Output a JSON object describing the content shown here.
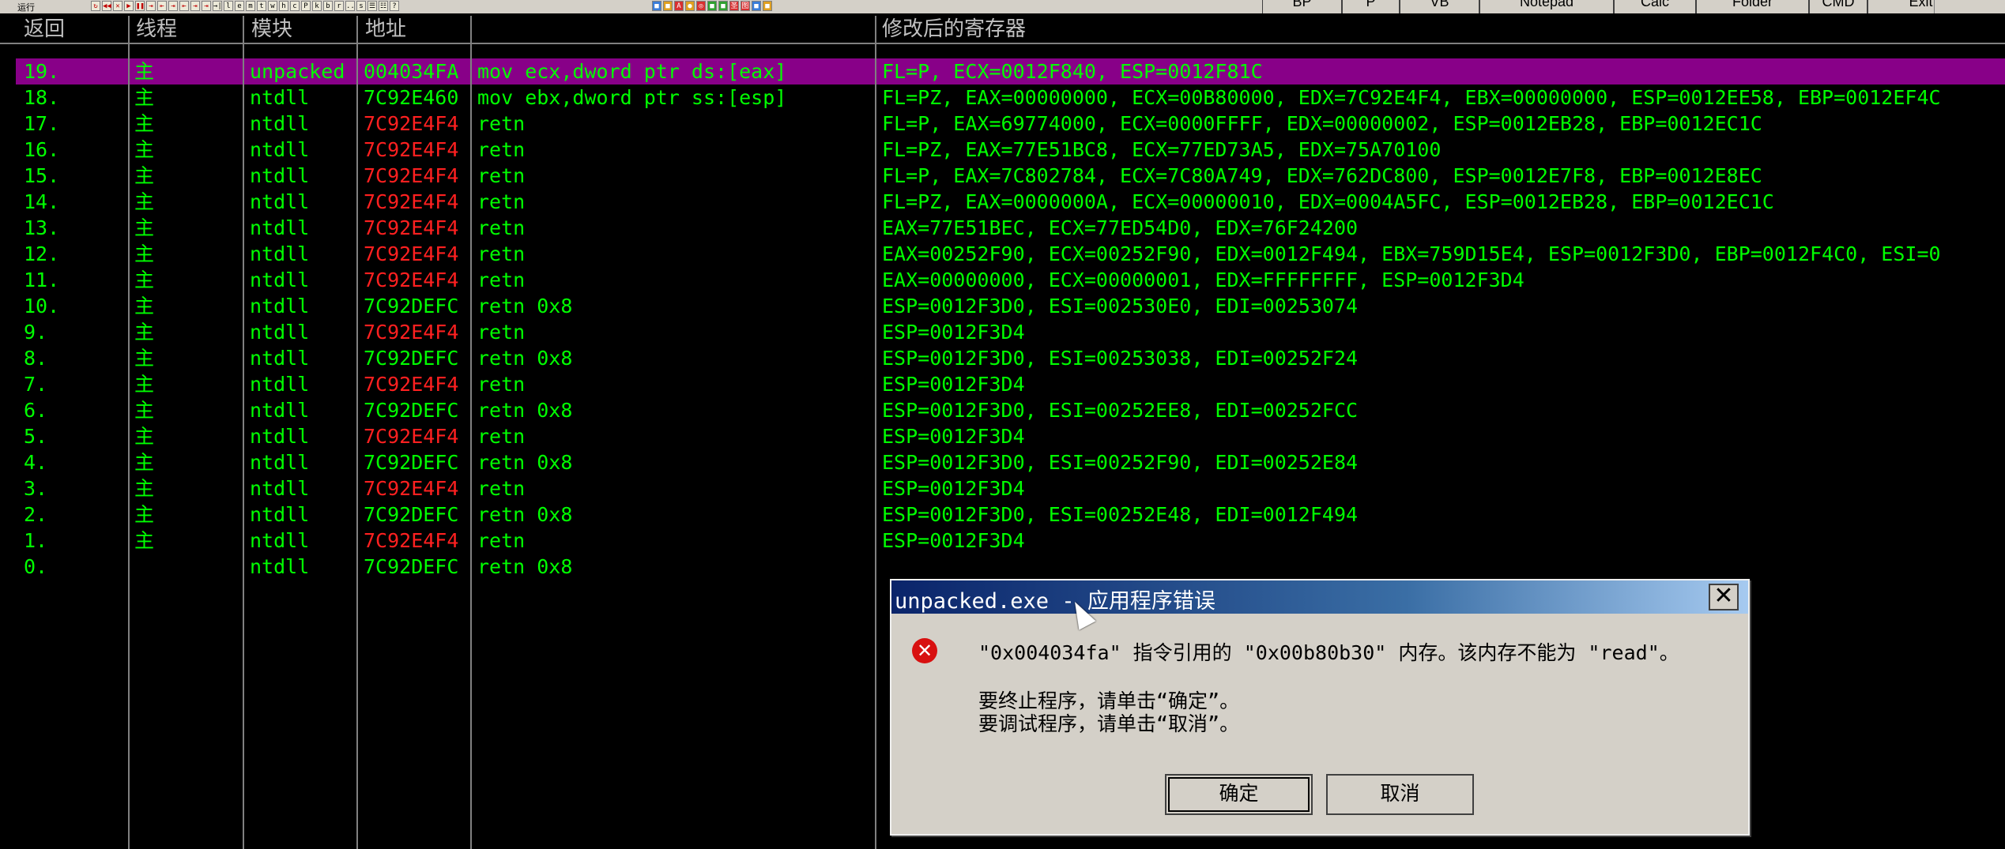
{
  "toolbar": {
    "label": "运行",
    "icons_group1": [
      "↻",
      "◀◀",
      "✕",
      "▶",
      "❚❚",
      "⇥",
      "⇤",
      "⇥",
      "⇤",
      "⇥",
      "⇥",
      "→|",
      "l",
      "e",
      "m",
      "t",
      "w",
      "h",
      "c",
      "P",
      "k",
      "b",
      "r",
      "...",
      "s",
      "☰",
      "☷",
      "?"
    ],
    "icons_group2": [
      "■",
      "■",
      "A",
      "●",
      "◎",
      "■",
      "■",
      "圣",
      "图",
      "■",
      "■"
    ],
    "buttons": [
      "BP",
      "P",
      "VB",
      "Notepad",
      "Calc",
      "Folder",
      "CMD",
      "Exit"
    ]
  },
  "columns": {
    "ret": "返回",
    "thread": "线程",
    "module": "模块",
    "address": "地址",
    "instruction": "",
    "registers": "修改后的寄存器"
  },
  "rows": [
    {
      "ret": "19.",
      "thread": "主",
      "module": "unpacked",
      "address": "004034FA",
      "addr_red": false,
      "instr": "mov ecx,dword ptr ds:[eax]",
      "regs": "FL=P, ECX=0012F840, ESP=0012F81C",
      "selected": true
    },
    {
      "ret": "18.",
      "thread": "主",
      "module": "ntdll",
      "address": "7C92E460",
      "addr_red": false,
      "instr": "mov ebx,dword ptr ss:[esp]",
      "regs": "FL=PZ, EAX=00000000, ECX=00B80000, EDX=7C92E4F4, EBX=00000000, ESP=0012EE58, EBP=0012EF4C",
      "selected": false
    },
    {
      "ret": "17.",
      "thread": "主",
      "module": "ntdll",
      "address": "7C92E4F4",
      "addr_red": true,
      "instr": "retn",
      "regs": "FL=P, EAX=69774000, ECX=0000FFFF, EDX=00000002, ESP=0012EB28, EBP=0012EC1C",
      "selected": false
    },
    {
      "ret": "16.",
      "thread": "主",
      "module": "ntdll",
      "address": "7C92E4F4",
      "addr_red": true,
      "instr": "retn",
      "regs": "FL=PZ, EAX=77E51BC8, ECX=77ED73A5, EDX=75A70100",
      "selected": false
    },
    {
      "ret": "15.",
      "thread": "主",
      "module": "ntdll",
      "address": "7C92E4F4",
      "addr_red": true,
      "instr": "retn",
      "regs": "FL=P, EAX=7C802784, ECX=7C80A749, EDX=762DC800, ESP=0012E7F8, EBP=0012E8EC",
      "selected": false
    },
    {
      "ret": "14.",
      "thread": "主",
      "module": "ntdll",
      "address": "7C92E4F4",
      "addr_red": true,
      "instr": "retn",
      "regs": "FL=PZ, EAX=0000000A, ECX=00000010, EDX=0004A5FC, ESP=0012EB28, EBP=0012EC1C",
      "selected": false
    },
    {
      "ret": "13.",
      "thread": "主",
      "module": "ntdll",
      "address": "7C92E4F4",
      "addr_red": true,
      "instr": "retn",
      "regs": "EAX=77E51BEC, ECX=77ED54D0, EDX=76F24200",
      "selected": false
    },
    {
      "ret": "12.",
      "thread": "主",
      "module": "ntdll",
      "address": "7C92E4F4",
      "addr_red": true,
      "instr": "retn",
      "regs": "EAX=00252F90, ECX=00252F90, EDX=0012F494, EBX=759D15E4, ESP=0012F3D0, EBP=0012F4C0, ESI=0",
      "selected": false
    },
    {
      "ret": "11.",
      "thread": "主",
      "module": "ntdll",
      "address": "7C92E4F4",
      "addr_red": true,
      "instr": "retn",
      "regs": "EAX=00000000, ECX=00000001, EDX=FFFFFFFF, ESP=0012F3D4",
      "selected": false
    },
    {
      "ret": "10.",
      "thread": "主",
      "module": "ntdll",
      "address": "7C92DEFC",
      "addr_red": false,
      "instr": "retn 0x8",
      "regs": "ESP=0012F3D0, ESI=002530E0, EDI=00253074",
      "selected": false
    },
    {
      "ret": "9.",
      "thread": "主",
      "module": "ntdll",
      "address": "7C92E4F4",
      "addr_red": true,
      "instr": "retn",
      "regs": "ESP=0012F3D4",
      "selected": false
    },
    {
      "ret": "8.",
      "thread": "主",
      "module": "ntdll",
      "address": "7C92DEFC",
      "addr_red": false,
      "instr": "retn 0x8",
      "regs": "ESP=0012F3D0, ESI=00253038, EDI=00252F24",
      "selected": false
    },
    {
      "ret": "7.",
      "thread": "主",
      "module": "ntdll",
      "address": "7C92E4F4",
      "addr_red": true,
      "instr": "retn",
      "regs": "ESP=0012F3D4",
      "selected": false
    },
    {
      "ret": "6.",
      "thread": "主",
      "module": "ntdll",
      "address": "7C92DEFC",
      "addr_red": false,
      "instr": "retn 0x8",
      "regs": "ESP=0012F3D0, ESI=00252EE8, EDI=00252FCC",
      "selected": false
    },
    {
      "ret": "5.",
      "thread": "主",
      "module": "ntdll",
      "address": "7C92E4F4",
      "addr_red": true,
      "instr": "retn",
      "regs": "ESP=0012F3D4",
      "selected": false
    },
    {
      "ret": "4.",
      "thread": "主",
      "module": "ntdll",
      "address": "7C92DEFC",
      "addr_red": false,
      "instr": "retn 0x8",
      "regs": "ESP=0012F3D0, ESI=00252F90, EDI=00252E84",
      "selected": false
    },
    {
      "ret": "3.",
      "thread": "主",
      "module": "ntdll",
      "address": "7C92E4F4",
      "addr_red": true,
      "instr": "retn",
      "regs": "ESP=0012F3D4",
      "selected": false
    },
    {
      "ret": "2.",
      "thread": "主",
      "module": "ntdll",
      "address": "7C92DEFC",
      "addr_red": false,
      "instr": "retn 0x8",
      "regs": "ESP=0012F3D0, ESI=00252E48, EDI=0012F494",
      "selected": false
    },
    {
      "ret": "1.",
      "thread": "主",
      "module": "ntdll",
      "address": "7C92E4F4",
      "addr_red": true,
      "instr": "retn",
      "regs": "ESP=0012F3D4",
      "selected": false
    },
    {
      "ret": "0.",
      "thread": "",
      "module": "ntdll",
      "address": "7C92DEFC",
      "addr_red": false,
      "instr": "retn 0x8",
      "regs": "",
      "selected": false
    }
  ],
  "dialog": {
    "title": "unpacked.exe - 应用程序错误",
    "message": "\"0x004034fa\" 指令引用的 \"0x00b80b30\" 内存。该内存不能为 \"read\"。",
    "line2": "要终止程序，请单击“确定”。",
    "line3": "要调试程序，请单击“取消”。",
    "ok": "确定",
    "cancel": "取消",
    "close": "✕",
    "error_icon": "✕"
  },
  "colors": {
    "text_green": "#00ff00",
    "addr_red": "#ff2020",
    "selected_row": "#880088",
    "header_text": "#c0c0c0"
  }
}
